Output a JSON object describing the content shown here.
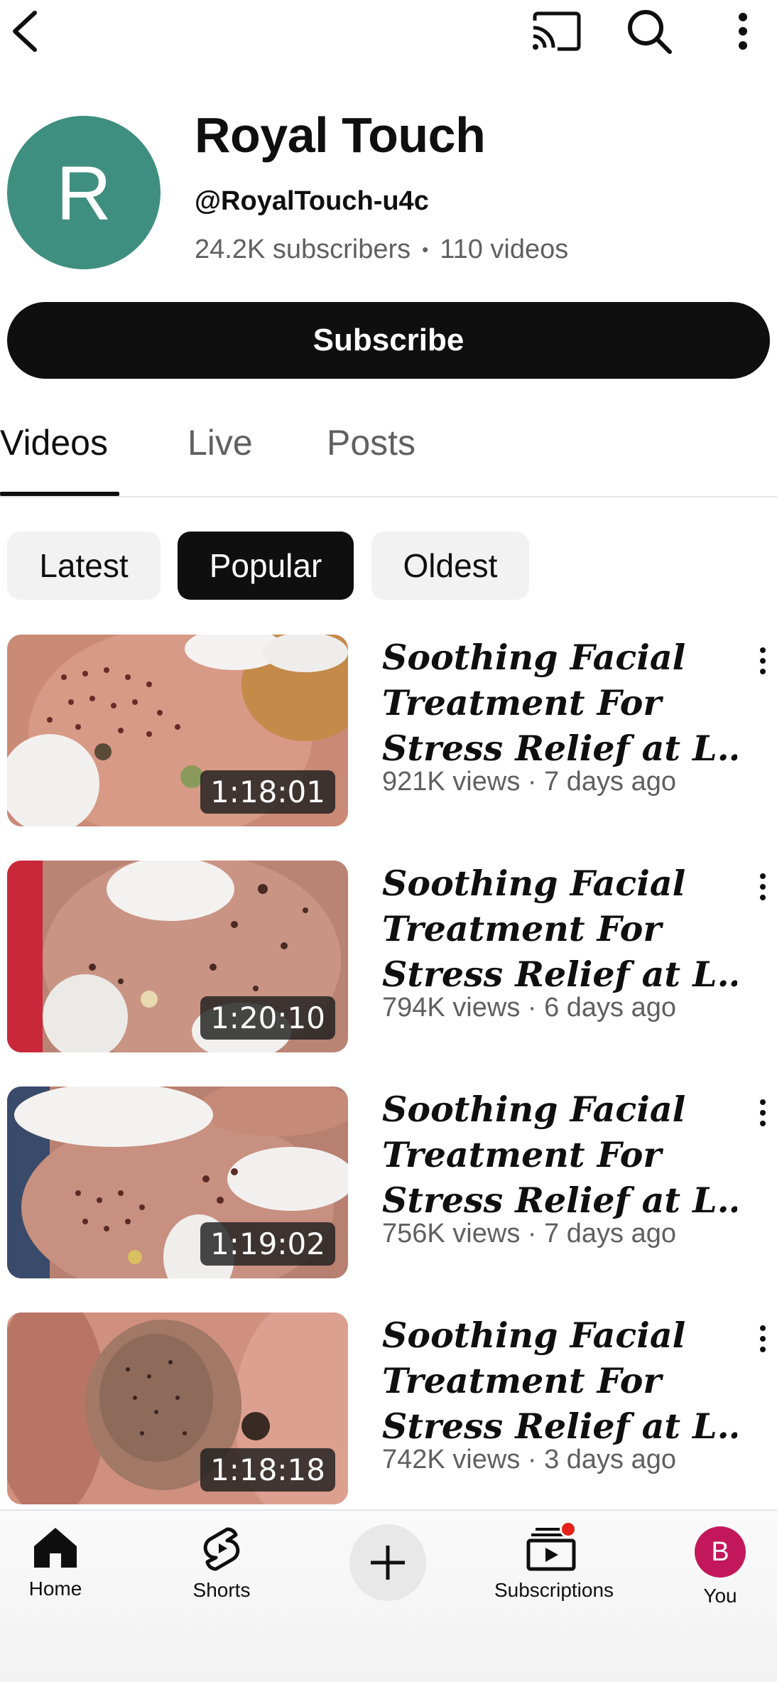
{
  "topbar": {
    "icons": [
      "back-arrow-icon",
      "cast-icon",
      "search-icon",
      "more-vert-icon"
    ]
  },
  "channel": {
    "avatar_letter": "R",
    "avatar_color": "#3f8f80",
    "name": "Royal Touch",
    "handle": "@RoyalTouch-u4c",
    "subscribers": "24.2K subscribers",
    "stats_separator": "•",
    "videos_count": "110 videos",
    "subscribe_label": "Subscribe"
  },
  "tabs": [
    {
      "label": "Videos",
      "active": true
    },
    {
      "label": "Live",
      "active": false
    },
    {
      "label": "Posts",
      "active": false
    }
  ],
  "filters": [
    {
      "label": "Latest",
      "selected": false
    },
    {
      "label": "Popular",
      "selected": true
    },
    {
      "label": "Oldest",
      "selected": false
    }
  ],
  "videos": [
    {
      "title_lines": [
        "Soothing Facial",
        "Treatment For",
        "Stress Relief at L…"
      ],
      "duration": "1:18:01",
      "meta": "921K views · 7 days ago"
    },
    {
      "title_lines": [
        "Soothing Facial",
        "Treatment For",
        "Stress Relief at L…"
      ],
      "duration": "1:20:10",
      "meta": "794K views · 6 days ago"
    },
    {
      "title_lines": [
        "Soothing Facial",
        "Treatment For",
        "Stress Relief at L…"
      ],
      "duration": "1:19:02",
      "meta": "756K views · 7 days ago"
    },
    {
      "title_lines": [
        "Soothing Facial",
        "Treatment For",
        "Stress Relief at L…"
      ],
      "duration": "1:18:18",
      "meta": "742K views · 3 days ago"
    }
  ],
  "bottom_nav": {
    "home": "Home",
    "shorts": "Shorts",
    "subscriptions": "Subscriptions",
    "you": "You",
    "you_avatar_letter": "B",
    "you_avatar_color": "#c2185b",
    "notification_color": "#e62117"
  }
}
